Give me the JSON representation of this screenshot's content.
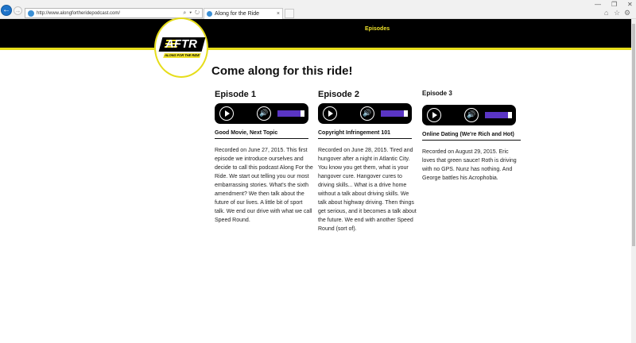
{
  "browser": {
    "url": "http://www.alongfortheridepodcast.com/",
    "address_tools": "⌕ ▾ ↻",
    "tab_title": "Along for the Ride",
    "tab_close": "×"
  },
  "site": {
    "nav": {
      "episodes": "Episodes"
    },
    "logo": {
      "text": "AFTR",
      "subtitle": "ALONG FOR THE RIDE"
    },
    "heading": "Come along for this ride!"
  },
  "episodes": [
    {
      "title": "Episode 1",
      "subtitle": "Good Movie, Next Topic",
      "description": "Recorded on June 27, 2015. This first episode we introduce ourselves and decide to call this podcast Along For the Ride. We start out telling you our most embarrassing stories. What's the sixth amendment? We then talk about the future of our lives. A little bit of sport talk. We end our drive with what we call Speed Round.",
      "volume": 0.85
    },
    {
      "title": "Episode 2",
      "subtitle": "Copyright Infringement 101",
      "description": "Recorded on June 28, 2015. Tired and hungover after a night in Atlantic City. You know you get them, what is your hangover cure. Hangover cures to driving skills... What is a drive home without a talk about driving skills. We talk about highway driving. Then things get serious, and it becomes a talk about the future. We end with another Speed Round (sort of).",
      "volume": 0.85
    },
    {
      "title": "Episode 3",
      "subtitle": "Online Dating (We're Rich and Hot)",
      "description": "Recorded on August 29, 2015. Eric loves that green sauce! Roth is driving with no GPS. Nunz has nothing. And George battles his Acrophobia.",
      "volume": 0.85
    }
  ],
  "colors": {
    "header_bg": "#000000",
    "accent_yellow": "#e6dd1a",
    "volume_fill": "#5a35c4"
  }
}
